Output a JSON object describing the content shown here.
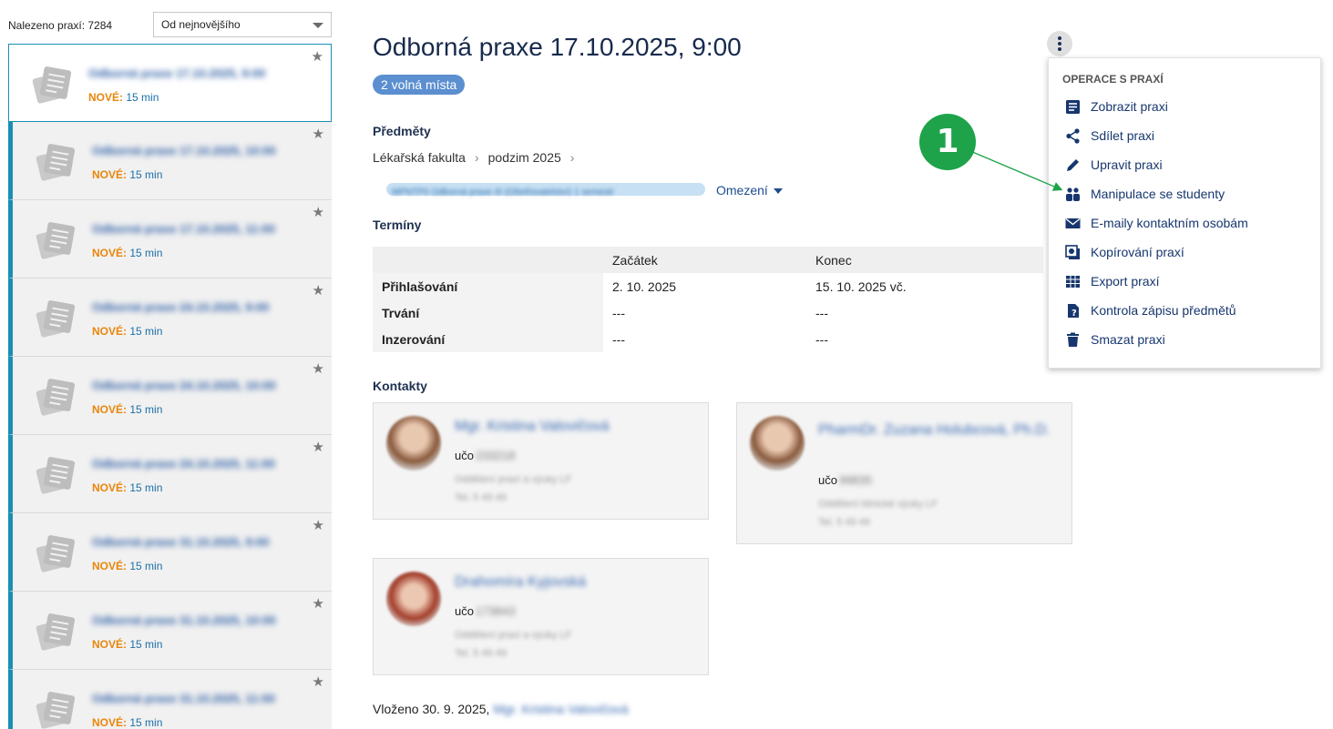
{
  "list": {
    "found_label": "Nalezeno praxí: 7284",
    "sort_selected": "Od nejnovějšího",
    "items": [
      {
        "title": "Odborná praxe 17.10.2025, 9:00",
        "new_label": "NOVÉ:",
        "duration": "15 min"
      },
      {
        "title": "Odborná praxe 17.10.2025, 10:00",
        "new_label": "NOVÉ:",
        "duration": "15 min"
      },
      {
        "title": "Odborná praxe 17.10.2025, 11:00",
        "new_label": "NOVÉ:",
        "duration": "15 min"
      },
      {
        "title": "Odborná praxe 24.10.2025, 9:00",
        "new_label": "NOVÉ:",
        "duration": "15 min"
      },
      {
        "title": "Odborná praxe 24.10.2025, 10:00",
        "new_label": "NOVÉ:",
        "duration": "15 min"
      },
      {
        "title": "Odborná praxe 24.10.2025, 11:00",
        "new_label": "NOVÉ:",
        "duration": "15 min"
      },
      {
        "title": "Odborná praxe 31.10.2025, 9:00",
        "new_label": "NOVÉ:",
        "duration": "15 min"
      },
      {
        "title": "Odborná praxe 31.10.2025, 10:00",
        "new_label": "NOVÉ:",
        "duration": "15 min"
      },
      {
        "title": "Odborná praxe 31.10.2025, 11:00",
        "new_label": "NOVÉ:",
        "duration": "15 min"
      }
    ]
  },
  "detail": {
    "title": "Odborná praxe 17.10.2025, 9:00",
    "badge": "2 volná místa",
    "subjects_label": "Předměty",
    "breadcrumb": [
      "Lékařská fakulta",
      "podzim 2025"
    ],
    "subject_chip": "MPNTP0 Odborná praxe III (Ošetřovatelství) 1 semestr",
    "restrict_label": "Omezení",
    "terms_label": "Termíny",
    "terms": {
      "headers": [
        "",
        "Začátek",
        "Konec"
      ],
      "rows": [
        {
          "label": "Přihlašování",
          "start": "2. 10. 2025",
          "end": "15. 10. 2025 vč."
        },
        {
          "label": "Trvání",
          "start": "---",
          "end": "---"
        },
        {
          "label": "Inzerování",
          "start": "---",
          "end": "---"
        }
      ]
    },
    "contacts_label": "Kontakty",
    "contacts": [
      {
        "name": "Mgr. Kristina Valovičová",
        "uco_label": "učo",
        "uco": "233218",
        "info1": "Oddělení praxí a výuky LF",
        "info2": "Tel. 5 49 49"
      },
      {
        "name": "PharmDr. Zuzana Holubcová, Ph.D.",
        "uco_label": "učo",
        "uco": "99835",
        "info1": "Oddělení klinické výuky LF",
        "info2": "Tel. 5 49 49"
      },
      {
        "name": "Drahomíra Kyjovská",
        "uco_label": "učo",
        "uco": "173843",
        "info1": "Oddělení praxí a výuky LF",
        "info2": "Tel. 5 49 49"
      }
    ],
    "posted_prefix": "Vloženo 30. 9. 2025,",
    "posted_by": "Mgr. Kristina Valovičová"
  },
  "menu": {
    "heading": "OPERACE S PRAXÍ",
    "items": [
      {
        "label": "Zobrazit praxi",
        "icon": "view-icon"
      },
      {
        "label": "Sdílet praxi",
        "icon": "share-icon"
      },
      {
        "label": "Upravit praxi",
        "icon": "pencil-icon"
      },
      {
        "label": "Manipulace se studenty",
        "icon": "students-icon"
      },
      {
        "label": "E-maily kontaktním osobám",
        "icon": "envelope-icon"
      },
      {
        "label": "Kopírování praxí",
        "icon": "copy-icon"
      },
      {
        "label": "Export praxí",
        "icon": "table-icon"
      },
      {
        "label": "Kontrola zápisu předmětů",
        "icon": "check-icon"
      },
      {
        "label": "Smazat praxi",
        "icon": "trash-icon"
      }
    ]
  },
  "annotation": {
    "number": "1",
    "color": "#1ea34a"
  },
  "colors": {
    "accent": "#1a8fb4",
    "link": "#17366e",
    "new": "#e8860c",
    "badge": "#5b8fd0"
  }
}
